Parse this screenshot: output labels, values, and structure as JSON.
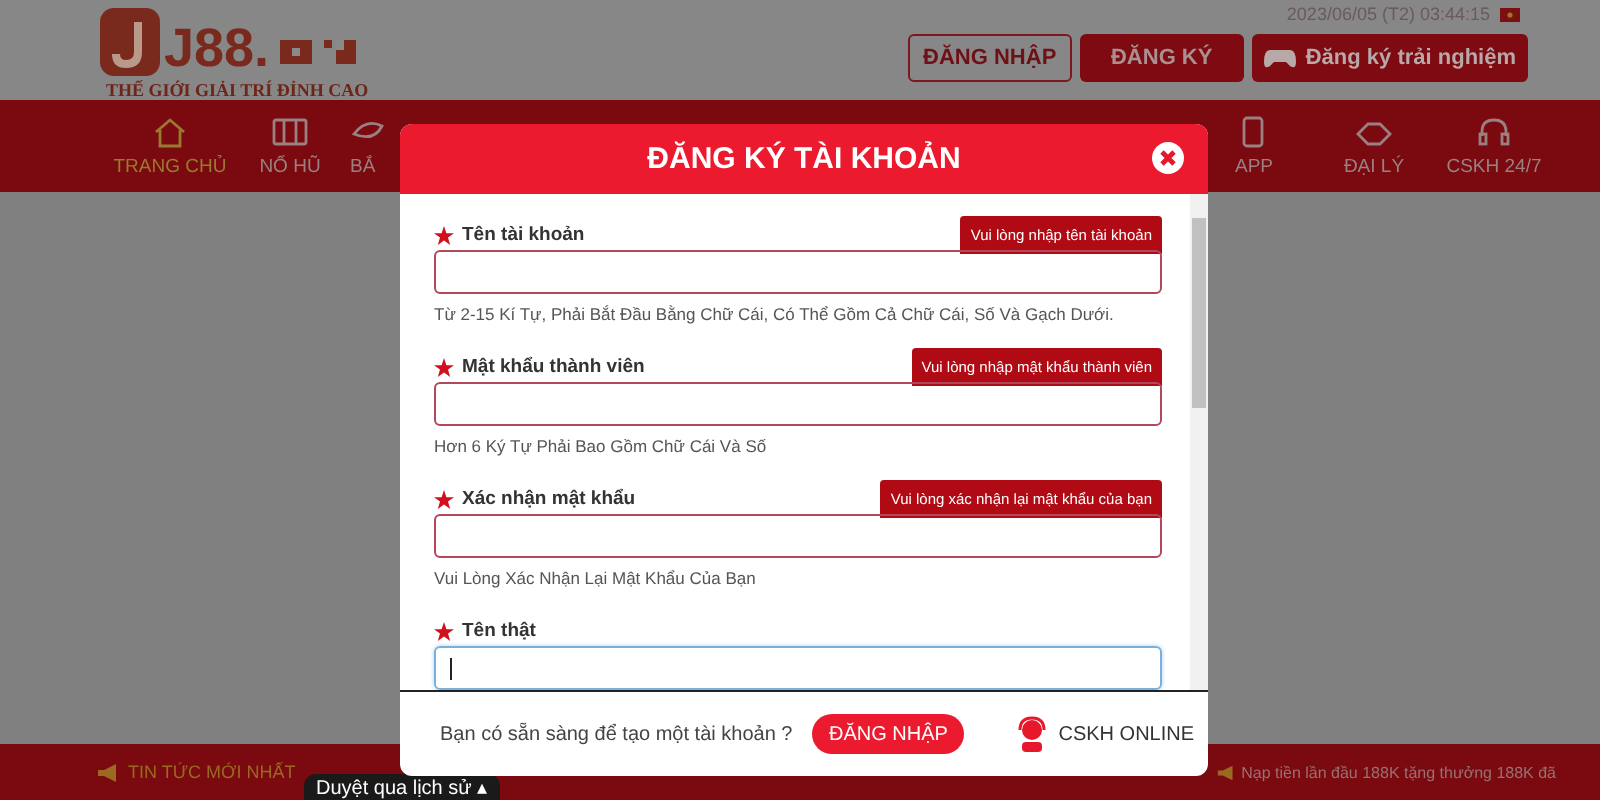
{
  "header": {
    "logo_text": "J88.",
    "tagline": "THẾ GIỚI GIẢI TRÍ ĐỈNH CAO",
    "datetime": "2023/06/05 (T2) 03:44:15",
    "buttons": [
      {
        "label": "ĐĂNG NHẬP",
        "kind": "outline"
      },
      {
        "label": "ĐĂNG KÝ",
        "kind": "filled"
      },
      {
        "label": "Đăng ký trải nghiệm",
        "kind": "icon"
      }
    ]
  },
  "nav": [
    {
      "label": "TRANG CHỦ",
      "selected": true
    },
    {
      "label": "NỔ HŨ",
      "selected": false
    },
    {
      "label": "BẮ",
      "selected": false
    },
    {
      "label": "APP",
      "selected": false
    },
    {
      "label": "ĐẠI LÝ",
      "selected": false
    },
    {
      "label": "CSKH 24/7",
      "selected": false
    }
  ],
  "modal": {
    "title": "ĐĂNG KÝ TÀI KHOẢN",
    "fields": [
      {
        "label": "Tên tài khoản",
        "error": "Vui lòng nhập tên tài khoản",
        "hint": "Từ 2-15 Kí Tự, Phải Bắt Đầu Bằng Chữ Cái, Có Thể Gồm Cả Chữ Cái, Số Và Gạch Dưới.",
        "focused": false
      },
      {
        "label": "Mật khẩu thành viên",
        "error": "Vui lòng nhập mật khẩu thành viên",
        "hint": "Hơn 6 Ký Tự Phải Bao Gồm Chữ Cái Và Số",
        "focused": false
      },
      {
        "label": "Xác nhận mật khẩu",
        "error": "Vui lòng xác nhận lại mật khẩu của bạn",
        "hint": "Vui Lòng Xác Nhận Lại Mật Khẩu Của Bạn",
        "focused": false
      },
      {
        "label": "Tên thật",
        "focused": true
      }
    ],
    "footer_question": "Bạn có sẵn sàng để tạo một tài khoản ?",
    "login_button": "ĐĂNG NHẬP",
    "support": "CSKH ONLINE"
  },
  "ticker": {
    "title": "TIN TỨC MỚI NHẤT",
    "message": "Nạp tiền lần đầu 188K tặng thưởng 188K đã"
  },
  "tooltip": "Duyệt qua lịch sử ▴"
}
